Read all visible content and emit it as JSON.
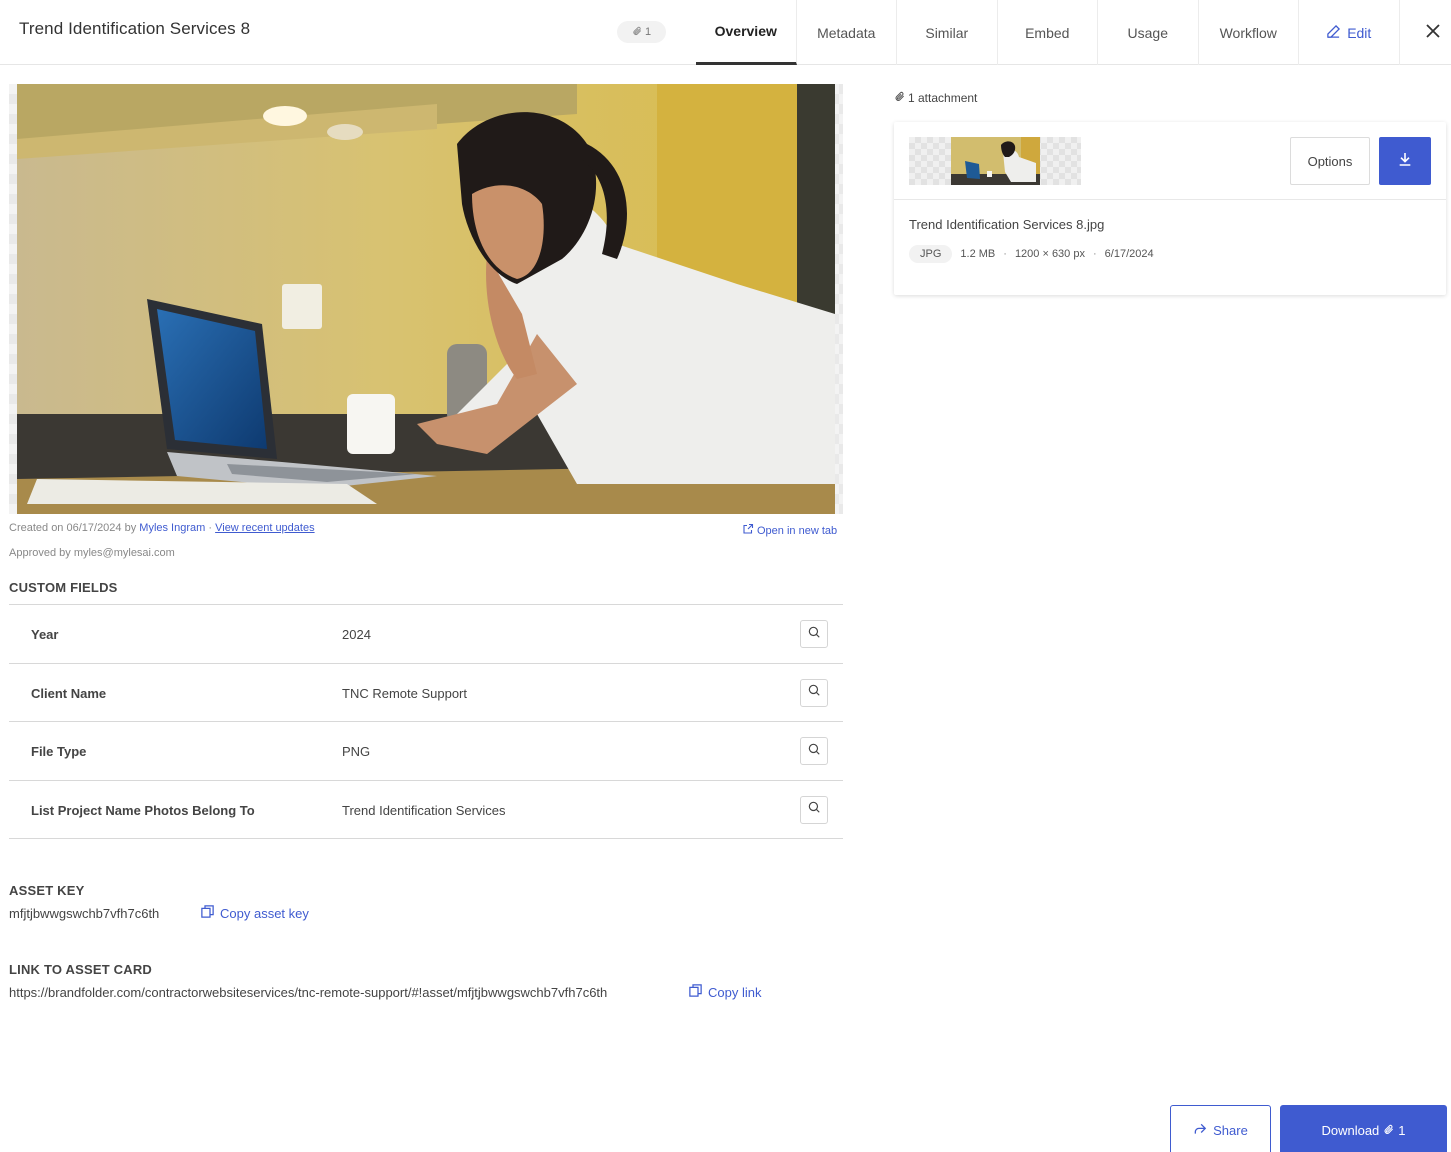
{
  "header": {
    "title": "Trend Identification Services 8",
    "attachment_count": "1",
    "tabs": [
      {
        "label": "Overview"
      },
      {
        "label": "Metadata"
      },
      {
        "label": "Similar"
      },
      {
        "label": "Embed"
      },
      {
        "label": "Usage"
      },
      {
        "label": "Workflow"
      },
      {
        "label": "Edit"
      }
    ]
  },
  "asset": {
    "created_prefix": "Created on 06/17/2024 by",
    "created_by": "Myles Ingram",
    "separator": "·",
    "view_updates": "View recent updates",
    "open_new_tab": "Open in new tab",
    "approved": "Approved by myles@mylesai.com"
  },
  "custom_fields": {
    "title": "CUSTOM FIELDS",
    "rows": [
      {
        "label": "Year",
        "value": "2024"
      },
      {
        "label": "Client Name",
        "value": "TNC Remote Support"
      },
      {
        "label": "File Type",
        "value": "PNG"
      },
      {
        "label": "List Project Name Photos Belong To",
        "value": "Trend Identification Services"
      }
    ]
  },
  "asset_key": {
    "title": "ASSET KEY",
    "value": "mfjtjbwwgswchb7vfh7c6th",
    "copy_label": "Copy asset key"
  },
  "asset_link": {
    "title": "LINK TO ASSET CARD",
    "value": "https://brandfolder.com/contractorwebsiteservices/tnc-remote-support/#!asset/mfjtjbwwgswchb7vfh7c6th",
    "copy_label": "Copy link"
  },
  "attachments": {
    "count_label": "1 attachment",
    "options_label": "Options",
    "file_name": "Trend Identification Services 8.jpg",
    "file_type": "JPG",
    "file_size": "1.2 MB",
    "dimensions": "1200 × 630 px",
    "date": "6/17/2024"
  },
  "footer": {
    "share_label": "Share",
    "download_label": "Download",
    "download_count": "1"
  },
  "colors": {
    "accent": "#3f5bd0"
  }
}
